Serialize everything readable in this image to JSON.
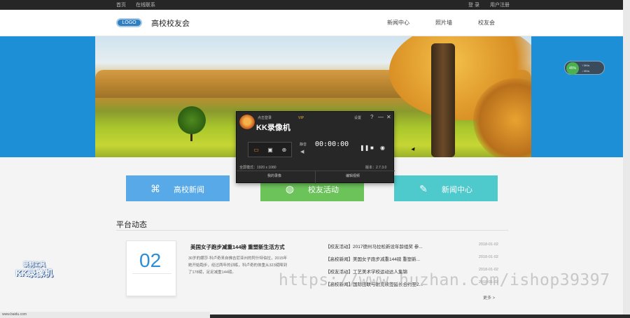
{
  "topbar": {
    "left_items": [
      "首页",
      "在线联系"
    ],
    "right_items": [
      "登 录",
      "用户注册"
    ]
  },
  "header": {
    "logo_text": "LOGO",
    "site_title": "高校校友会",
    "nav": [
      "新闻中心",
      "照片墙",
      "校友会"
    ]
  },
  "tiles": [
    {
      "label": "高校新闻",
      "icon": "grid-icon",
      "color": "#58a9e8"
    },
    {
      "label": "校友活动",
      "icon": "globe-icon",
      "color": "#6cc35a"
    },
    {
      "label": "新闻中心",
      "icon": "edit-icon",
      "color": "#4ec9cc"
    }
  ],
  "section": {
    "title": "平台动态",
    "more": "更多 >"
  },
  "featured": {
    "day": "02",
    "title": "美国女子跑步减重144磅 重塑新生活方式",
    "body": "30岁的娜莎·科卢奇来自佛吉尼亚州的阿什特伯拉，2015年她开始跑步，经过两年的训练，科卢奇的体重从323磅降到了178磅，足足减重144磅。"
  },
  "news": [
    {
      "title": "【校友活动】2017德州马拉松新设年龄组奖 参...",
      "date": "2018-01-02"
    },
    {
      "title": "【高校新闻】美国女子跑步减重144磅 重塑新...",
      "date": "2018-01-02"
    },
    {
      "title": "【校友活动】工艺美术学校运动达人集锦",
      "date": "2018-01-02"
    },
    {
      "title": "【高校新闻】国际田联与耐克续签延长合约至2...",
      "date": "2018-01-02"
    }
  ],
  "kk_recorder": {
    "top_left": "点击登录",
    "vip": "VIP",
    "settings": "设置",
    "help": "?",
    "minimize": "—",
    "close": "✕",
    "title": "KK录像机",
    "mute_label": "静音",
    "timer": "00:00:00",
    "resolution": "全屏模式：1920 x 1080",
    "version": "版本：2.7.3.0",
    "btn_my_videos": "我的录像",
    "btn_edit": "编辑视频"
  },
  "net_widget": {
    "percent": "45%",
    "up": "0K/s",
    "down": "0K/s"
  },
  "status_url": "www.baidu.com",
  "watermark_kk": {
    "line1": "录制工具",
    "line2": "KK录像机"
  },
  "watermark_url": "https://www.huzhan.com/ishop39397"
}
